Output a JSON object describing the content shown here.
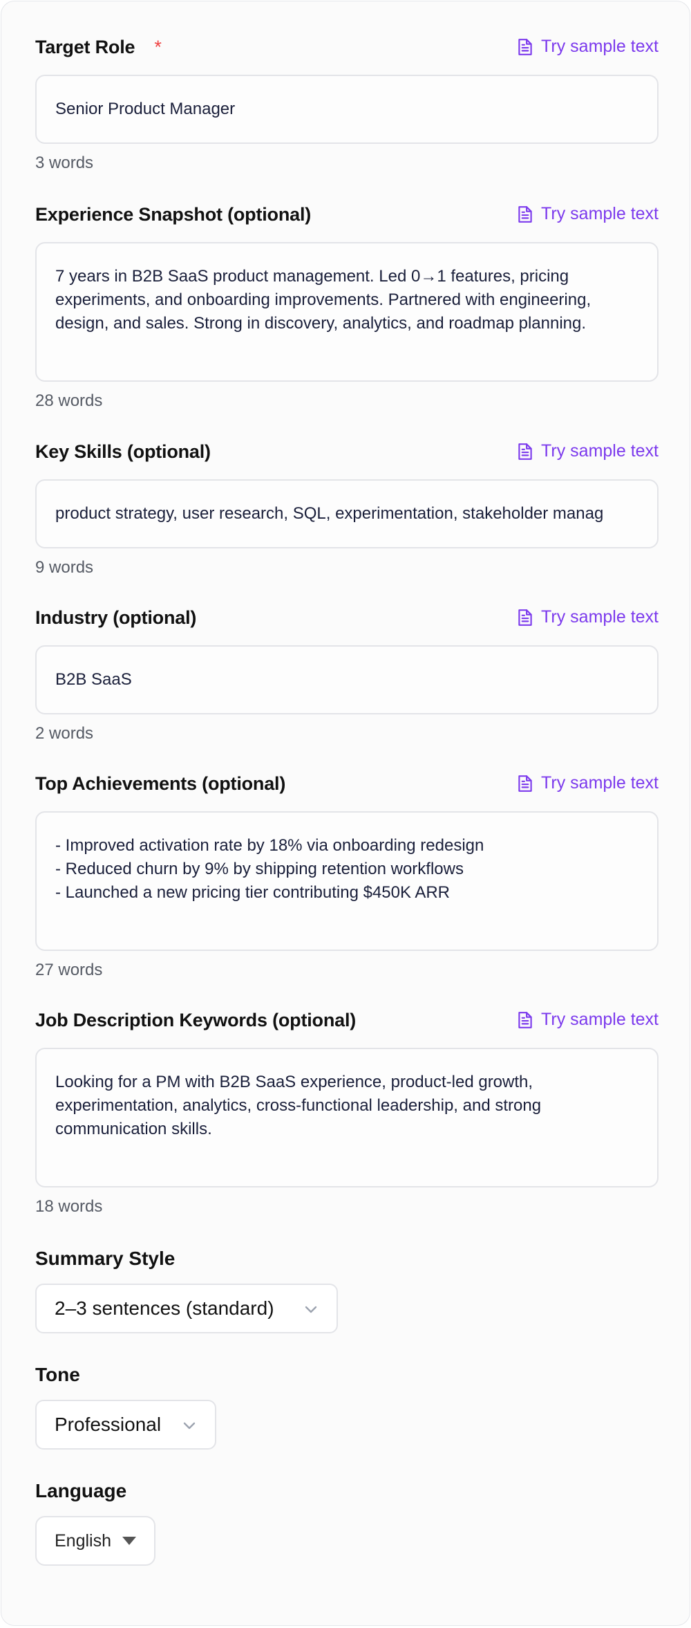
{
  "sample_link_label": "Try sample text",
  "required_marker": "*",
  "fields": [
    {
      "label": "Target Role",
      "value_lines": [
        "Senior Product Manager"
      ],
      "word_count": "3 words"
    },
    {
      "label": "Experience Snapshot (optional)",
      "value_lines": [
        "7 years in B2B SaaS product management. Led 0→1 features, pricing",
        "experiments, and onboarding improvements. Partnered with engineering,",
        "design, and sales. Strong in discovery, analytics, and roadmap planning."
      ],
      "word_count": "28 words"
    },
    {
      "label": "Key Skills (optional)",
      "value_lines": [
        "product strategy, user research, SQL, experimentation, stakeholder manag"
      ],
      "word_count": "9 words"
    },
    {
      "label": "Industry (optional)",
      "value_lines": [
        "B2B SaaS"
      ],
      "word_count": "2 words"
    },
    {
      "label": "Top Achievements (optional)",
      "value_lines": [
        "- Improved activation rate by 18% via onboarding redesign",
        "- Reduced churn by 9% by shipping retention workflows",
        "- Launched a new pricing tier contributing $450K ARR"
      ],
      "word_count": "27 words"
    },
    {
      "label": "Job Description Keywords (optional)",
      "value_lines": [
        "Looking for a PM with B2B SaaS experience, product-led growth,",
        "experimentation, analytics, cross-functional leadership, and strong",
        "communication skills."
      ],
      "word_count": "18 words"
    }
  ],
  "selects": [
    {
      "label": "Summary Style",
      "value": "2–3 sentences (standard)"
    },
    {
      "label": "Tone",
      "value": "Professional"
    },
    {
      "label": "Language",
      "value": "English"
    }
  ],
  "icons": {
    "sample": "document-icon",
    "select": "chevron-down-icon",
    "native_select": "caret-down-icon"
  },
  "colors": {
    "accent": "#7c3aed",
    "required": "#ef4444",
    "text": "#111111",
    "muted": "#555a64",
    "border": "#e3e4e8"
  }
}
